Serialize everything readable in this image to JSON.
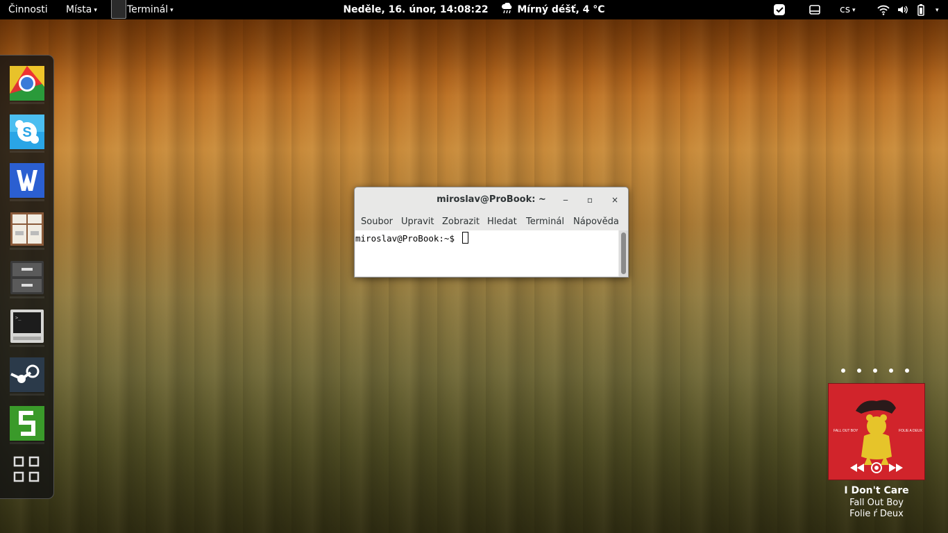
{
  "topbar": {
    "activities": "Činnosti",
    "places": "Místa",
    "app_menu": "Terminál",
    "clock": "Neděle, 16. únor, 14:08:22",
    "weather": "Mírný déšť, 4 °C",
    "keyboard_layout": "cs",
    "caret": "▾"
  },
  "dash": {
    "items": [
      {
        "name": "chrome",
        "icon": "chrome-icon"
      },
      {
        "name": "skype",
        "icon": "skype-icon"
      },
      {
        "name": "wps-writer",
        "icon": "wps-writer-icon"
      },
      {
        "name": "cabinet",
        "icon": "cabinet-icon"
      },
      {
        "name": "file-cabinet",
        "icon": "file-cabinet-icon"
      },
      {
        "name": "terminal",
        "icon": "terminal-icon"
      },
      {
        "name": "steam",
        "icon": "steam-icon"
      },
      {
        "name": "spreadsheet",
        "icon": "spreadsheet-icon"
      },
      {
        "name": "show-apps",
        "icon": "grid-icon"
      }
    ]
  },
  "terminal_window": {
    "title": "miroslav@ProBook: ~",
    "menu": [
      "Soubor",
      "Upravit",
      "Zobrazit",
      "Hledat",
      "Terminál",
      "Nápověda"
    ],
    "prompt": "miroslav@ProBook:~$ ",
    "minimize": "‒",
    "maximize": "▫",
    "close": "×"
  },
  "music": {
    "title": "I Don't Care",
    "artist": "Fall Out Boy",
    "album": "Folie ŕ Deux",
    "album_cover_text_left": "FALL OUT BOY",
    "album_cover_text_right": "FOLIE A DEUX",
    "page_count": 5
  },
  "colors": {
    "topbar_bg": "#000000",
    "album_red": "#d1242b"
  }
}
